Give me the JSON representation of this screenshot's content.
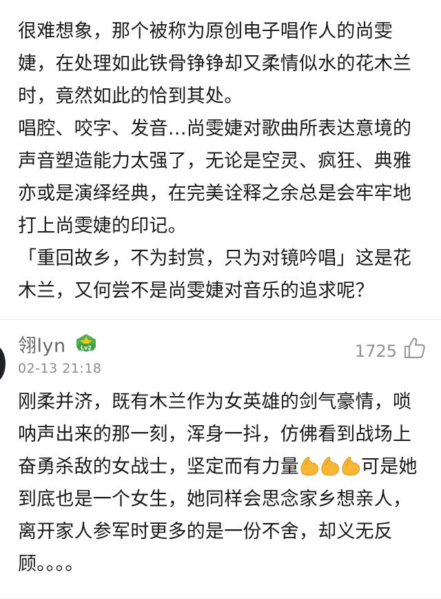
{
  "previous_comment": {
    "paragraphs": [
      "很难想象，那个被称为原创电子唱作人的尚雯婕，在处理如此铁骨铮铮却又柔情似水的花木兰时，竟然如此的恰到其处。",
      "唱腔、咬字、发音…尚雯婕对歌曲所表达意境的声音塑造能力太强了，无论是空灵、疯狂、典雅亦或是演绎经典，在完美诠释之余总是会牢牢地打上尚雯婕的印记。",
      "「重回故乡，不为封赏，只为对镜吟唱」这是花木兰，又何尝不是尚雯婕对音乐的追求呢？"
    ]
  },
  "comment": {
    "username": "翎lyn",
    "level_badge_icon": "level-2-badge-icon",
    "level_badge_text": "Lv2",
    "timestamp": "02-13 21:18",
    "like_count": "1725",
    "text_part1": "刚柔并济，既有木兰作为女英雄的剑气豪情，唢呐声出来的那一刻，浑身一抖，仿佛看到战场上奋勇杀敌的女战士，坚定而有力量",
    "emoji_name": "flexed-biceps-icon",
    "text_part2": "可是她到底也是一个女生，她同样会思念家乡想亲人，离开家人参军时更多的是一份不舍，却义无反顾。。。。"
  },
  "colors": {
    "text": "#1a1a1a",
    "meta": "#8a8a8a",
    "username": "#666666",
    "badge_green": "#4caf50",
    "badge_yellow": "#f5c518"
  }
}
